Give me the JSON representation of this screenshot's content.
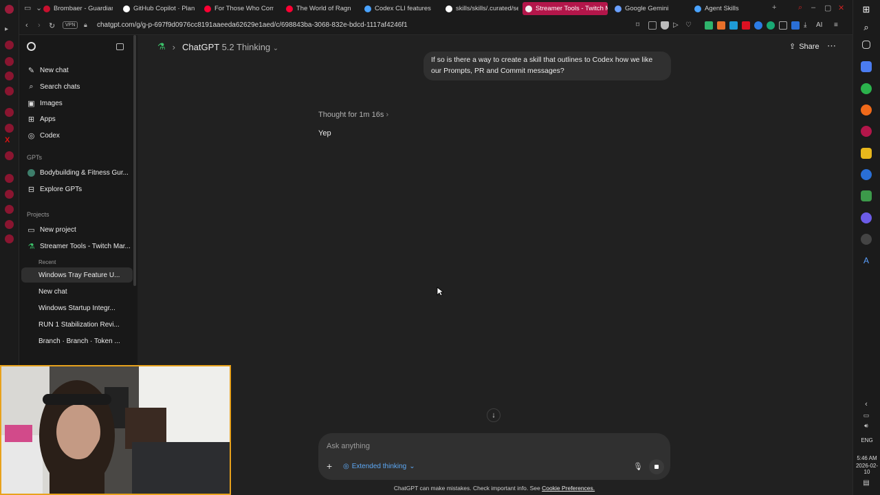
{
  "browser": {
    "tabs": [
      {
        "title": "Brombaer - Guardian of",
        "color": "#c8102e"
      },
      {
        "title": "GitHub Copilot · Plans",
        "color": "#ffffff"
      },
      {
        "title": "For Those Who Come",
        "color": "#ff0033"
      },
      {
        "title": "The World of Ragn",
        "color": "#ff0033"
      },
      {
        "title": "Codex CLI features",
        "color": "#4aa3ff"
      },
      {
        "title": "skills/skills/.curated/se",
        "color": "#ffffff"
      },
      {
        "title": "Streamer Tools - Twitch M",
        "color": "#f0f0f0"
      },
      {
        "title": "Google Gemini",
        "color": "#6aa0ff"
      },
      {
        "title": "Agent Skills",
        "color": "#4aa3ff"
      }
    ],
    "url": "chatgpt.com/g/g-p-697f9d0976cc8191aaeeda62629e1aed/c/698843ba-3068-832e-bdcd-1117af4246f1",
    "vpn_label": "VPN",
    "ai_label": "AI"
  },
  "sidebar": {
    "items": [
      {
        "label": "New chat",
        "icon": "compose-icon"
      },
      {
        "label": "Search chats",
        "icon": "search-icon"
      },
      {
        "label": "Images",
        "icon": "image-icon"
      },
      {
        "label": "Apps",
        "icon": "apps-icon"
      },
      {
        "label": "Codex",
        "icon": "codex-icon"
      }
    ],
    "gpts_header": "GPTs",
    "gpts": [
      {
        "label": "Bodybuilding & Fitness Gur..."
      },
      {
        "label": "Explore GPTs"
      }
    ],
    "projects_header": "Projects",
    "projects": [
      {
        "label": "New project"
      },
      {
        "label": "Streamer Tools - Twitch Mar..."
      }
    ],
    "recent_header": "Recent",
    "recent": [
      {
        "label": "Windows Tray Feature U..."
      },
      {
        "label": "New chat"
      },
      {
        "label": "Windows Startup Integr..."
      },
      {
        "label": "RUN 1 Stabilization Revi..."
      },
      {
        "label": "Branch · Branch · Token ..."
      }
    ]
  },
  "header": {
    "model": "ChatGPT",
    "version": "5.2 Thinking",
    "share_label": "Share"
  },
  "conversation": {
    "user_message": "If so is there a way to create a skill that outlines to Codex how we like our Prompts, PR and Commit messages?",
    "thought_label": "Thought for 1m 16s",
    "assistant_reply": "Yep"
  },
  "composer": {
    "placeholder": "Ask anything",
    "extended_label": "Extended thinking"
  },
  "footer": {
    "disclaimer": "ChatGPT can make mistakes. Check important info. See",
    "link": "Cookie Preferences."
  },
  "taskbar": {
    "lang": "ENG",
    "time": "5:46 AM",
    "date": "2026-02-10"
  },
  "colors": {
    "accent": "#5da9f6",
    "active_tab": "#b3164a",
    "webcam_border": "#e8a21c"
  }
}
